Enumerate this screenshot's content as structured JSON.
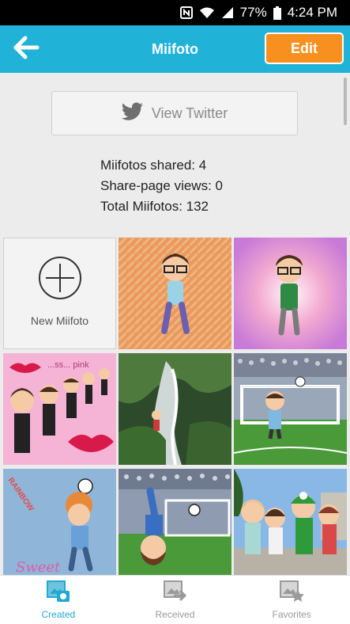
{
  "status_bar": {
    "battery": "77%",
    "time": "4:24 PM",
    "icons": [
      "nfc-icon",
      "wifi-icon",
      "signal-icon",
      "battery-icon"
    ]
  },
  "app_bar": {
    "title": "Miifoto",
    "edit_label": "Edit",
    "back_icon": "back-arrow-icon",
    "color": "#21b2d8",
    "edit_color": "#f7901e"
  },
  "twitter": {
    "label": "View Twitter",
    "icon": "twitter-bird-icon"
  },
  "stats": {
    "shared": "Miifotos shared: 4",
    "views": "Share-page views: 0",
    "total": "Total Miifotos: 132"
  },
  "grid": {
    "new_label": "New Miifoto",
    "thumbnails": [
      "orange-pattern-mii-photo",
      "pink-burst-mii-photo",
      "pink-lips-mii-photo",
      "waterfall-mii-photo",
      "stadium-goal-mii-photo",
      "rainbow-soccer-mii-photo",
      "stadium-bicycle-kick-mii-photo",
      "group-mii-photo"
    ],
    "overlay_text": {
      "pink_photo": "...ss... pink",
      "rainbow_photo": "RAINBOW",
      "sweet_photo": "Sweet"
    }
  },
  "bottom_nav": {
    "items": [
      {
        "label": "Created",
        "icon": "created-photos-icon",
        "active": true
      },
      {
        "label": "Received",
        "icon": "received-photos-icon",
        "active": false
      },
      {
        "label": "Favorites",
        "icon": "favorites-photos-icon",
        "active": false
      }
    ],
    "active_color": "#21a9d1"
  }
}
